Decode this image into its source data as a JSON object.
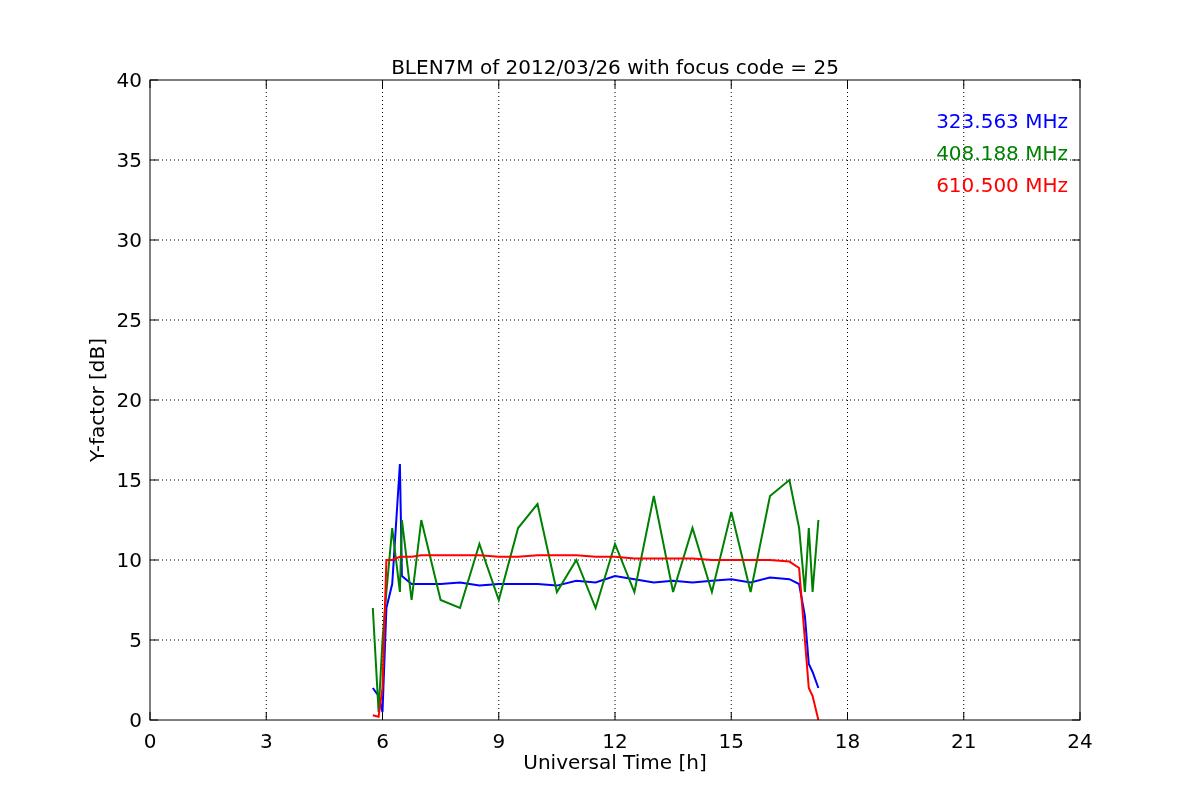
{
  "chart_data": {
    "type": "line",
    "title": "BLEN7M of 2012/03/26 with focus code = 25",
    "xlabel": "Universal Time [h]",
    "ylabel": "Y-factor [dB]",
    "x": [
      5.75,
      5.9,
      6.0,
      6.1,
      6.25,
      6.45,
      6.5,
      6.75,
      7,
      7.5,
      8,
      8.5,
      9,
      9.5,
      10,
      10.5,
      11,
      11.5,
      12,
      12.5,
      13,
      13.5,
      14,
      14.5,
      15,
      15.5,
      16,
      16.5,
      16.75,
      16.9,
      17,
      17.1,
      17.25
    ],
    "series": [
      {
        "name": "323.563 MHz",
        "color": "#0000ff",
        "values": [
          2,
          1.5,
          0.5,
          7,
          8.5,
          16,
          9,
          8.5,
          8.5,
          8.5,
          8.6,
          8.4,
          8.5,
          8.5,
          8.5,
          8.4,
          8.7,
          8.6,
          9,
          8.8,
          8.6,
          8.7,
          8.6,
          8.7,
          8.8,
          8.6,
          8.9,
          8.8,
          8.5,
          6.5,
          3.5,
          3,
          2
        ]
      },
      {
        "name": "408.188 MHz",
        "color": "#008000",
        "values": [
          7,
          0.5,
          5,
          8,
          12,
          8,
          12.5,
          7.5,
          12.5,
          7.5,
          7,
          11,
          7.5,
          12,
          13.5,
          8,
          10,
          7,
          11,
          8,
          14,
          8,
          12,
          8,
          13,
          8,
          14,
          15,
          12,
          8,
          12,
          8,
          12.5
        ]
      },
      {
        "name": "610.500 MHz",
        "color": "#ff0000",
        "values": [
          0.3,
          0.2,
          2,
          10,
          10,
          10.2,
          10.2,
          10.2,
          10.3,
          10.3,
          10.3,
          10.3,
          10.2,
          10.2,
          10.3,
          10.3,
          10.3,
          10.2,
          10.2,
          10.1,
          10.1,
          10.1,
          10.1,
          10,
          10,
          10,
          10,
          9.9,
          9.5,
          5,
          2,
          1.5,
          0
        ]
      }
    ],
    "grid": true,
    "xlim": [
      0,
      24
    ],
    "ylim": [
      0,
      40
    ],
    "xticks": [
      0,
      3,
      6,
      9,
      12,
      15,
      18,
      21,
      24
    ],
    "yticks": [
      0,
      5,
      10,
      15,
      20,
      25,
      30,
      35,
      40
    ]
  }
}
